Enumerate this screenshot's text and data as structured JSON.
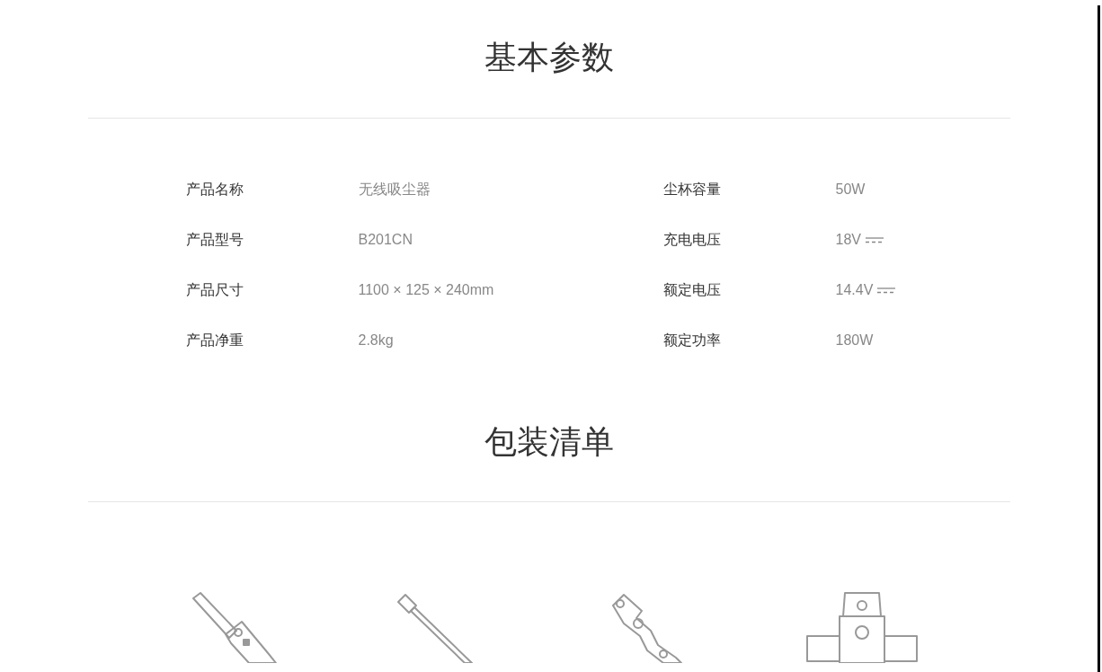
{
  "sections": [
    {
      "title": "基本参数"
    },
    {
      "title": "包装清单"
    }
  ],
  "specs": [
    {
      "label": "产品名称",
      "value": "无线吸尘器",
      "dc_symbol": false
    },
    {
      "label": "尘杯容量",
      "value": "50W",
      "dc_symbol": false
    },
    {
      "label": "产品型号",
      "value": "B201CN",
      "dc_symbol": false
    },
    {
      "label": "充电电压",
      "value": "18V",
      "dc_symbol": true
    },
    {
      "label": "产品尺寸",
      "value": "1100 × 125 × 240mm",
      "dc_symbol": false
    },
    {
      "label": "额定电压",
      "value": "14.4V",
      "dc_symbol": true
    },
    {
      "label": "产品净重",
      "value": "2.8kg",
      "dc_symbol": false
    },
    {
      "label": "额定功率",
      "value": "180W",
      "dc_symbol": false
    }
  ],
  "package_items": [
    {
      "kind": "handheld"
    },
    {
      "kind": "tube"
    },
    {
      "kind": "adapter"
    },
    {
      "kind": "floorhead"
    }
  ]
}
